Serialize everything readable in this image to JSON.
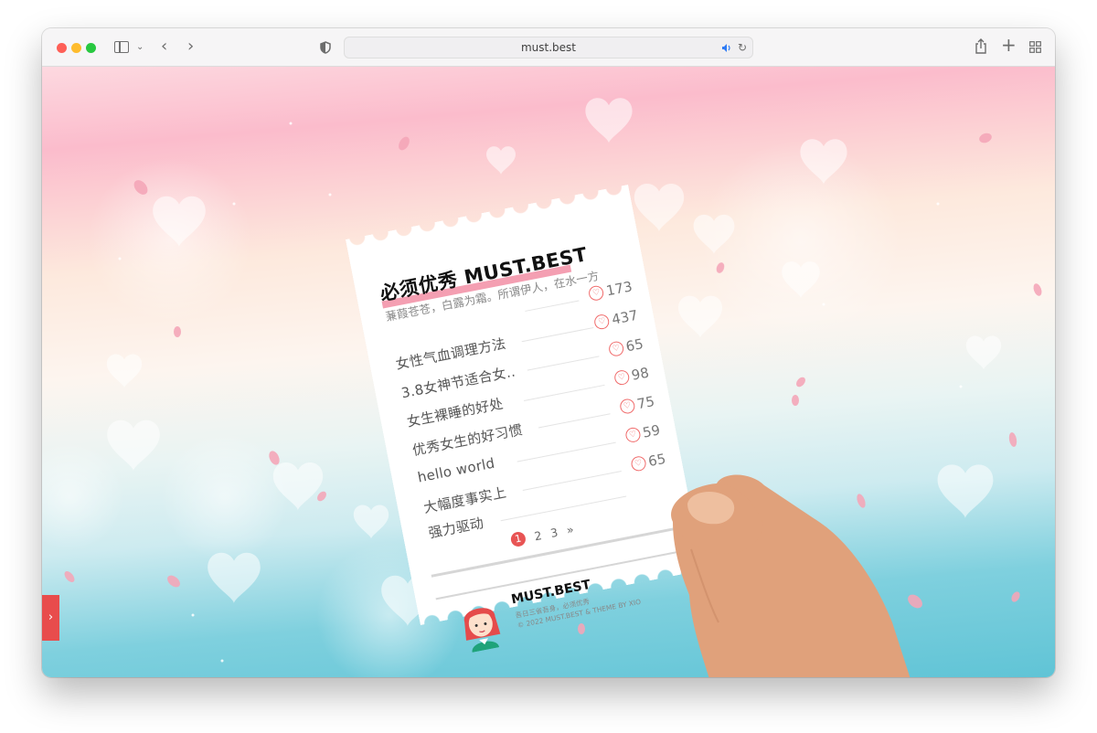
{
  "browser": {
    "url": "must.best",
    "icons": [
      "sidebar-icon",
      "chevron-down-icon",
      "back-icon",
      "forward-icon",
      "shield-icon",
      "speaker-icon",
      "reload-icon",
      "share-icon",
      "new-tab-icon",
      "tab-overview-icon"
    ]
  },
  "card": {
    "title": "必须优秀 MUST.BEST",
    "subtitle": "蒹葭苍苍，白露为霜。所谓伊人，在水一方",
    "items": [
      {
        "label": "",
        "likes": "173"
      },
      {
        "label": "女性气血调理方法",
        "likes": "437"
      },
      {
        "label": "3.8女神节适合女..",
        "likes": "65"
      },
      {
        "label": "女生裸睡的好处",
        "likes": "98"
      },
      {
        "label": "优秀女生的好习惯",
        "likes": "75"
      },
      {
        "label": "hello world",
        "likes": "59"
      },
      {
        "label": "大幅度事实上",
        "likes": "65"
      },
      {
        "label": "强力驱动",
        "likes": ""
      }
    ],
    "pagination": {
      "pages": [
        "1",
        "2",
        "3"
      ],
      "next": "»",
      "current": "1"
    },
    "footer": {
      "brand": "MUST.BEST",
      "tagline": "吾日三省吾身，必须优秀",
      "copyright": "© 2022 MUST.BEST & THEME BY XIO"
    }
  },
  "side_tab": {
    "icon": "chevron-right-icon"
  },
  "colors": {
    "accent": "#e84c4c",
    "heart": "#f06a6a"
  }
}
